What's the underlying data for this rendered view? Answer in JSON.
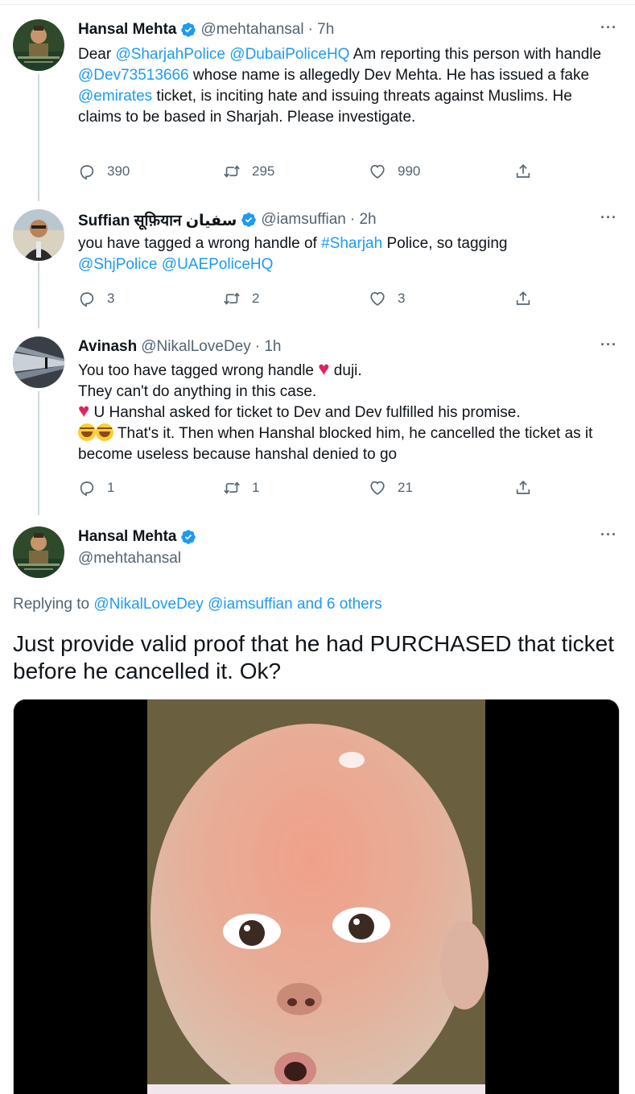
{
  "colors": {
    "link": "#1d9bf0",
    "muted": "#536471",
    "verified": "#1d9bf0",
    "heart": "#e0245e"
  },
  "tweets": [
    {
      "name": "Hansal Mehta",
      "handle": "@mehtahansal",
      "time": "· 7h",
      "body": [
        {
          "t": "Dear "
        },
        {
          "t": "@SharjahPolice",
          "link": true
        },
        {
          "t": " "
        },
        {
          "t": "@DubaiPoliceHQ",
          "link": true
        },
        {
          "t": " Am reporting this person with handle  "
        },
        {
          "t": "@Dev73513666",
          "link": true
        },
        {
          "t": " whose name is allegedly Dev Mehta. He has issued a fake "
        },
        {
          "t": "@emirates",
          "link": true
        },
        {
          "t": " ticket, is inciting hate and issuing threats against Muslims. He claims to be based in Sharjah. Please investigate."
        }
      ],
      "replies": "390",
      "retweets": "295",
      "likes": "990"
    },
    {
      "name": "Suffian सूफ़ियान سفیان",
      "handle": "@iamsuffian",
      "time": "· 2h",
      "body": [
        {
          "t": "you have tagged a wrong handle of "
        },
        {
          "t": "#Sharjah",
          "link": true
        },
        {
          "t": " Police, so tagging"
        },
        {
          "br": true
        },
        {
          "t": "@ShjPolice",
          "link": true
        },
        {
          "t": " "
        },
        {
          "t": "@UAEPoliceHQ",
          "link": true
        }
      ],
      "replies": "3",
      "retweets": "2",
      "likes": "3"
    },
    {
      "name": "Avinash",
      "handle": "@NikalLoveDey",
      "time": "· 1h",
      "body": [
        {
          "t": "You too have tagged wrong handle "
        },
        {
          "emoji": "heart"
        },
        {
          "t": " duji."
        },
        {
          "br": true
        },
        {
          "t": "They can't do anything in this case."
        },
        {
          "br": true
        },
        {
          "emoji": "heart"
        },
        {
          "t": " U Hanshal asked for ticket to Dev and Dev fulfilled his promise."
        },
        {
          "br": true
        },
        {
          "emoji": "laugh"
        },
        {
          "emoji": "laugh"
        },
        {
          "t": " That's it. Then when Hanshal blocked him, he cancelled the ticket as it become useless because hanshal denied to go"
        }
      ],
      "replies": "1",
      "retweets": "1",
      "likes": "21"
    }
  ],
  "main_tweet": {
    "name": "Hansal Mehta",
    "handle": "@mehtahansal",
    "replying_prefix": "Replying to ",
    "replying_to": "@NikalLoveDey @iamsuffian and 6 others",
    "text": "Just provide valid proof that he had PURCHASED that ticket before he cancelled it. Ok?"
  },
  "more_label": "···"
}
